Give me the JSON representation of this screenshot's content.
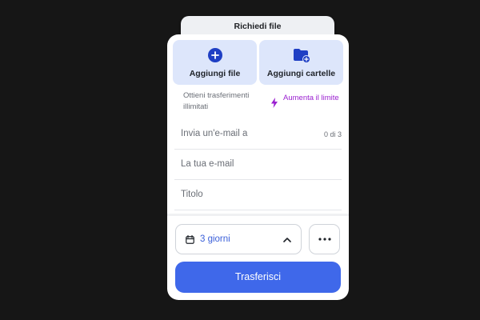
{
  "back_tab": {
    "title": "Richiedi file"
  },
  "upload": {
    "add_files_label": "Aggiungi file",
    "add_folders_label": "Aggiungi cartelle"
  },
  "promo": {
    "text": "Ottieni trasferimenti illimitati",
    "upgrade_label": "Aumenta il limite"
  },
  "form": {
    "recipient_placeholder": "Invia un'e-mail a",
    "recipient_counter": "0 di 3",
    "sender_placeholder": "La tua e-mail",
    "title_placeholder": "Titolo"
  },
  "options": {
    "expiry_label": "3 giorni"
  },
  "actions": {
    "transfer_label": "Trasferisci"
  },
  "colors": {
    "accent": "#3f68ea",
    "tile_background": "#dde6fb",
    "upgrade_purple": "#9a1fd0",
    "page_background": "#161616"
  },
  "icons": {
    "add_files": "plus-circle-icon",
    "add_folders": "folder-plus-icon",
    "upgrade": "bolt-icon",
    "expiry": "calendar-icon",
    "expiry_toggle": "chevron-up-icon",
    "more": "more-horizontal-icon"
  }
}
